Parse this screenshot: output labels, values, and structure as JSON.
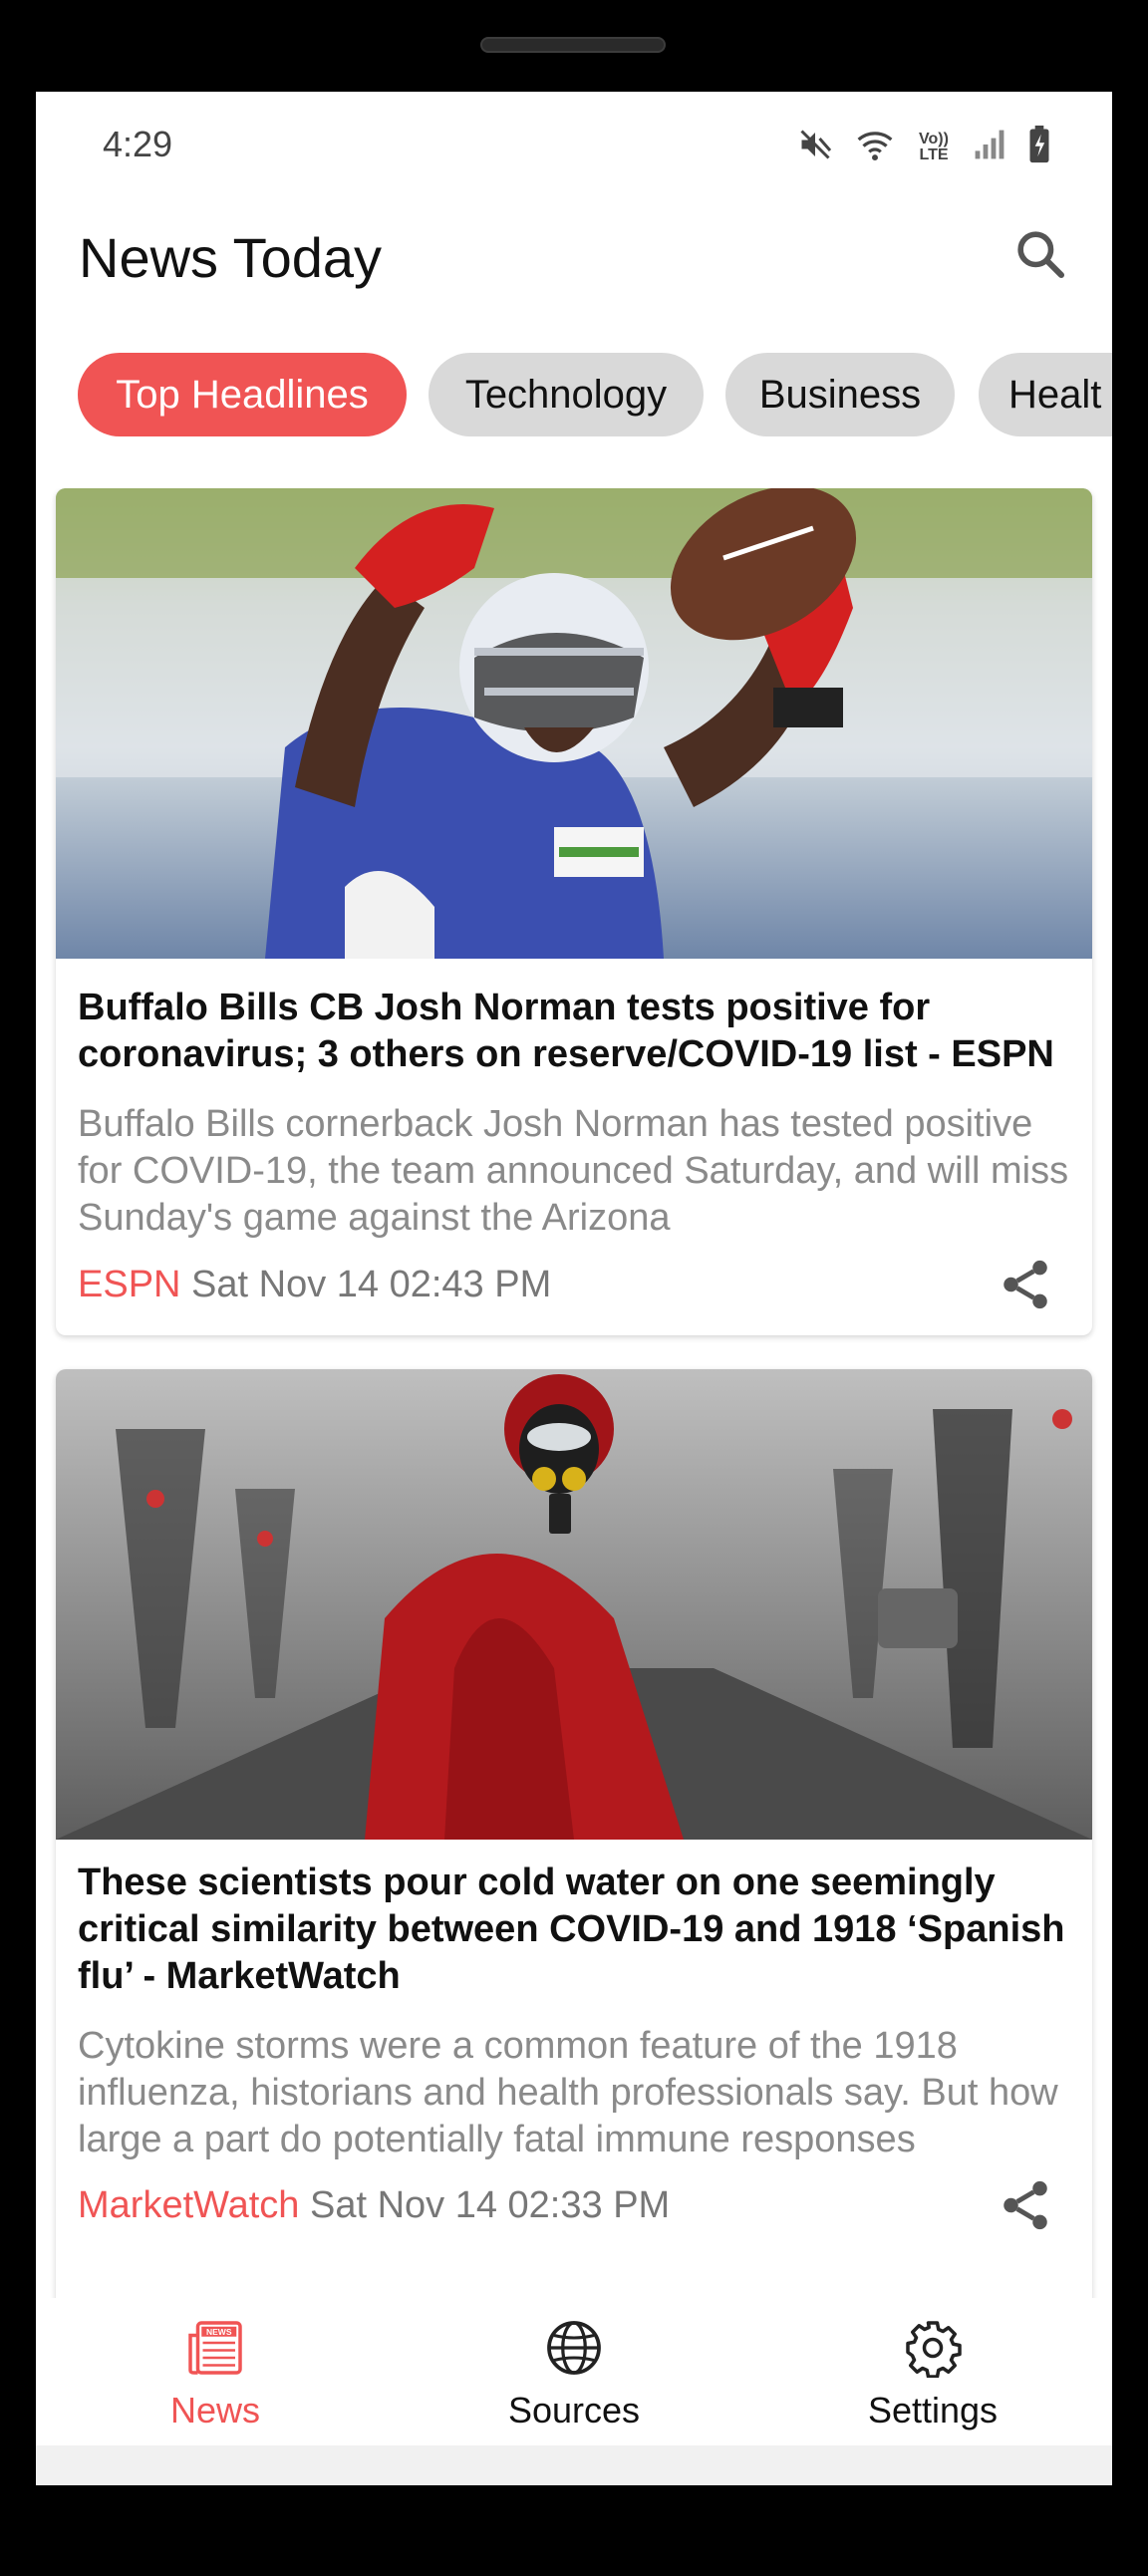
{
  "status_bar": {
    "time": "4:29",
    "icons": [
      "mute-icon",
      "wifi-icon",
      "volte-icon",
      "signal-icon",
      "battery-icon"
    ],
    "volte_text": "Vo)) LTE"
  },
  "app_bar": {
    "title": "News Today",
    "search_icon": "search-icon"
  },
  "categories": {
    "selected": "Top Headlines",
    "items": [
      "Top Headlines",
      "Technology",
      "Business",
      "Healt"
    ]
  },
  "articles": [
    {
      "headline": "Buffalo Bills CB Josh Norman tests positive for coronavirus; 3 others on reserve/COVID-19 list - ESPN",
      "description": "Buffalo Bills cornerback Josh Norman has tested positive for COVID-19, the team announced Saturday, and will miss Sunday's game against the Arizona",
      "source": "ESPN",
      "date": "Sat Nov 14 02:43 PM",
      "share_icon": "share-icon"
    },
    {
      "headline": "These scientists pour cold water on one seemingly critical similarity between COVID-19 and 1918 ‘Spanish flu’ - MarketWatch",
      "description": "Cytokine storms were a common feature of the 1918 influenza, historians and health professionals say. But how large a part do potentially fatal immune responses",
      "source": "MarketWatch",
      "date": "Sat Nov 14 02:33 PM",
      "share_icon": "share-icon"
    }
  ],
  "bottom_nav": {
    "selected": "News",
    "items": [
      {
        "label": "News",
        "icon": "newspaper-icon"
      },
      {
        "label": "Sources",
        "icon": "globe-icon"
      },
      {
        "label": "Settings",
        "icon": "gear-icon"
      }
    ]
  },
  "system_nav": [
    "recent-apps-icon",
    "home-icon",
    "back-icon"
  ],
  "colors": {
    "accent": "#f05454",
    "chip_inactive": "#d9d9d9",
    "text_primary": "#111111",
    "text_secondary": "#8a8a8a",
    "system_nav_bg": "#f1f1f1"
  }
}
